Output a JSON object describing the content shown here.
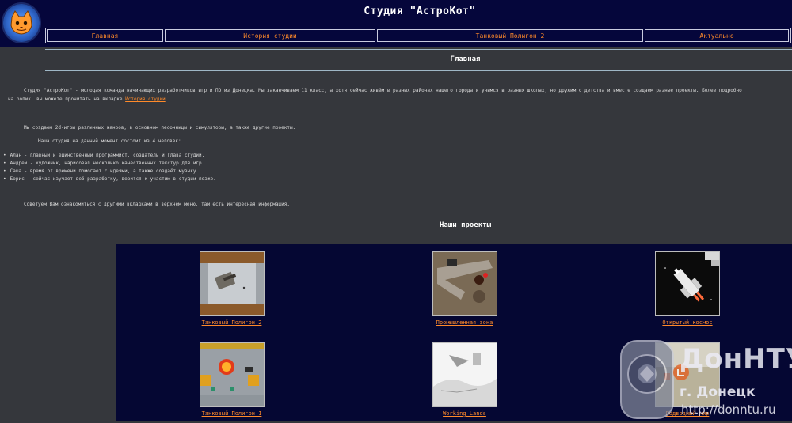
{
  "header": {
    "title": "Студия \"АстроКот\"",
    "logo_icon": "cat-head-icon"
  },
  "nav": {
    "items": [
      {
        "label": "Главная"
      },
      {
        "label": "История студии"
      },
      {
        "label": "Танковый Полигон 2"
      },
      {
        "label": "Актуально"
      }
    ]
  },
  "main": {
    "heading": "Главная",
    "intro_before_link": "Студия \"АстроКот\" - молодая команда начинающих разработчиков игр и ПО из Донецка. Мы заканчиваем 11 класс, а хотя сейчас живём в разных районах нашего города и учимся в разных школах, но дружим с детства и вместе создаем разные проекты. Более подробно",
    "intro_line2": "на ролик, вы можете прочитать на вкладке",
    "intro_link": "История студии",
    "intro_tail": ".",
    "games_text": "Мы создаем 2d-игры различных жанров, в основном песочницы и симуляторы, а также другие проекты.",
    "team_intro": "Наша студия на данный момент состоит из 4 человек:",
    "team": [
      "Алан - главный и единственный программист, создатель и глава студии.",
      "Андрей - художник, нарисовал несколько качественных текстур для игр.",
      "Саша - время от времени помогает с идеями, а также создаёт музыку.",
      "Борис - сейчас изучает веб-разработку, верится к участию в студии позже."
    ],
    "advice": "Советуем Вам ознакомиться с другими вкладками в верхнем меню, там есть интересная информация."
  },
  "projects": {
    "heading": "Наши проекты",
    "items": [
      {
        "label": "Танковый Полигон 2"
      },
      {
        "label": "Промышленная зона"
      },
      {
        "label": "Открытый космос"
      },
      {
        "label": "Танковый Полигон 1"
      },
      {
        "label": "Working Lands"
      },
      {
        "label": "Подводный мир"
      }
    ]
  },
  "watermark": {
    "line1": "ДонНТУ",
    "line2": "г. Донецк",
    "line3": "http://donntu.ru"
  },
  "colors": {
    "header_bg": "#05063b",
    "page_bg": "#35373c",
    "link": "#ff8a2a",
    "grid_cell_bg": "#050733"
  }
}
